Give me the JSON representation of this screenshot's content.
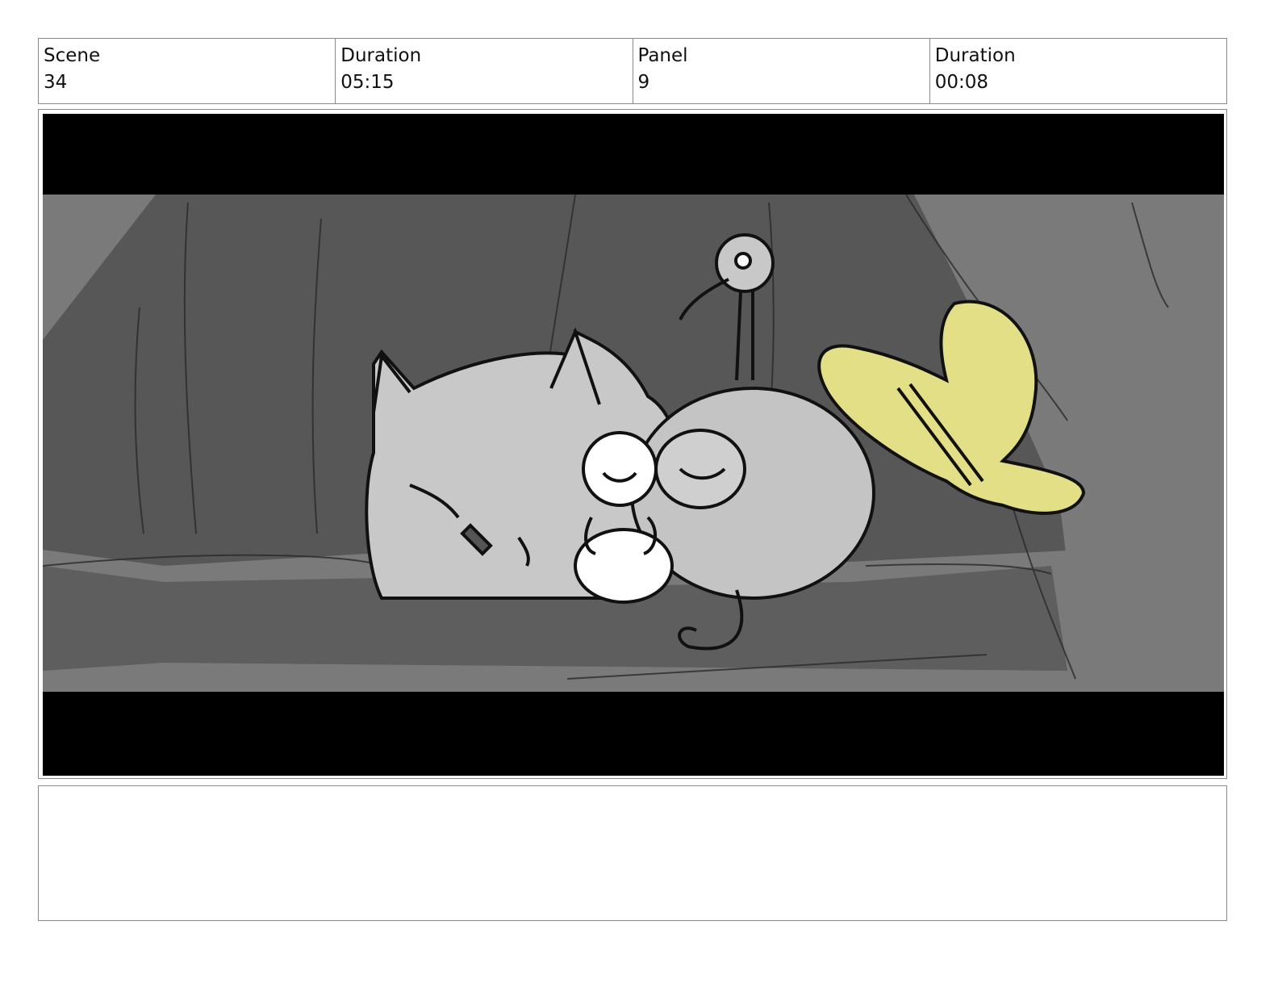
{
  "header": {
    "scene_label": "Scene",
    "scene_value": "34",
    "duration_label": "Duration",
    "duration_value": "05:15",
    "panel_label": "Panel",
    "panel_value": "9",
    "panel_duration_label": "Duration",
    "panel_duration_value": "00:08"
  },
  "panel_image": {
    "letterbox_color": "#000000",
    "hat_color": "#e2df86",
    "creature_color": "#c8c8c8",
    "background_color": "#575757"
  },
  "notes": {
    "text": ""
  }
}
